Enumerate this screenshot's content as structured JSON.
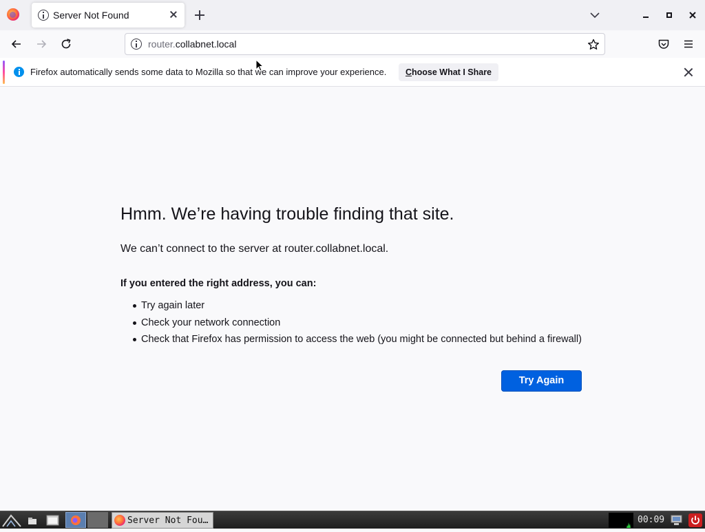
{
  "browser": {
    "tab": {
      "title": "Server Not Found"
    },
    "url": {
      "subdomain": "router.",
      "domain": "collabnet.local"
    }
  },
  "notification": {
    "text": "Firefox automatically sends some data to Mozilla so that we can improve your experience.",
    "button_accel": "C",
    "button_rest": "hoose What I Share"
  },
  "error": {
    "title": "Hmm. We’re having trouble finding that site.",
    "description": "We can’t connect to the server at router.collabnet.local.",
    "subtitle": "If you entered the right address, you can:",
    "suggestions": [
      "Try again later",
      "Check your network connection",
      "Check that Firefox has permission to access the web (you might be connected but behind a firewall)"
    ],
    "try_again": "Try Again"
  },
  "taskbar": {
    "window_label": "Server Not Fou…",
    "clock": "00:09"
  },
  "colors": {
    "accent": "#0061e0",
    "info_blue": "#0090ed",
    "power_red": "#cc1f1f"
  }
}
